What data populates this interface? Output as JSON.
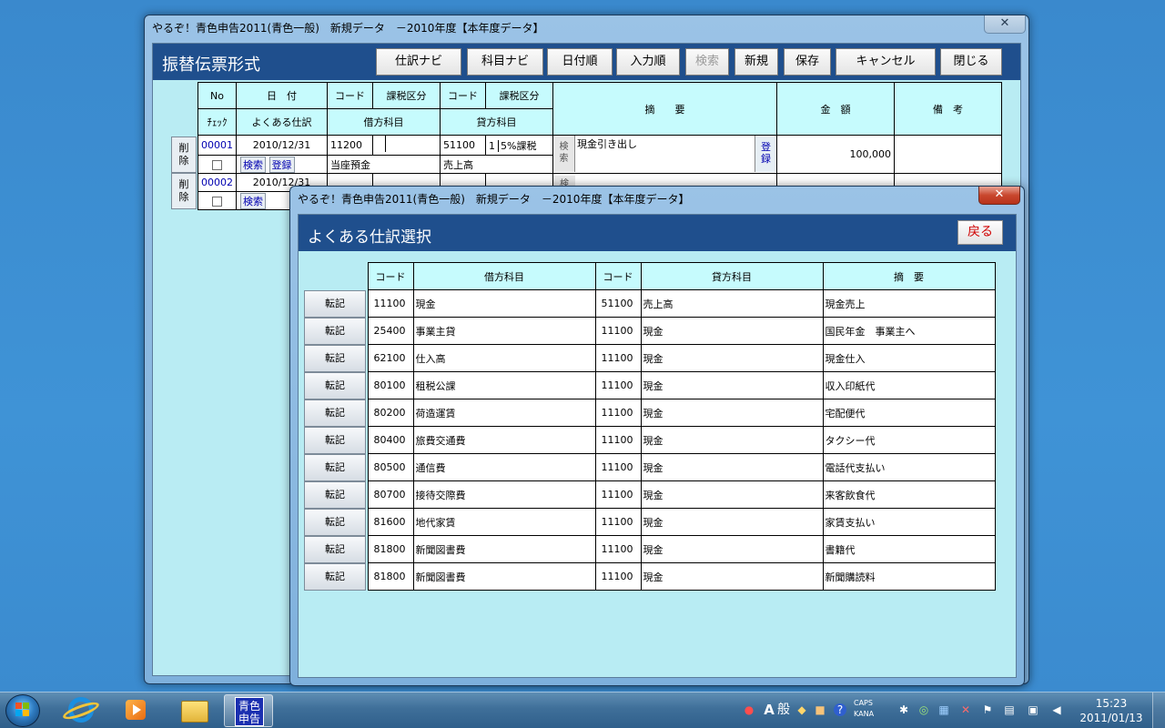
{
  "main_window": {
    "title": "やるぞ！青色申告2011(青色一般)　新規データ　－2010年度【本年度データ】",
    "close_label": "✕",
    "header_title": "振替伝票形式",
    "toolbar": [
      {
        "label": "仕訳ナビ",
        "disabled": false
      },
      {
        "label": "科目ナビ",
        "disabled": false
      },
      {
        "label": "日付順",
        "disabled": false
      },
      {
        "label": "入力順",
        "disabled": false
      },
      {
        "label": "検索",
        "disabled": true
      },
      {
        "label": "新規",
        "disabled": false
      },
      {
        "label": "保存",
        "disabled": false
      },
      {
        "label": "キャンセル",
        "disabled": false
      },
      {
        "label": "閉じる",
        "disabled": false
      }
    ],
    "grid_headers": {
      "no": "No",
      "date": "日　付",
      "code1": "コード",
      "tax1": "課税区分",
      "code2": "コード",
      "tax2": "課税区分",
      "summary": "摘　　要",
      "amount": "金　額",
      "note": "備　考",
      "check": "ﾁｪｯｸ",
      "frequent": "よくある仕訳",
      "debit": "借方科目",
      "credit": "貸方科目"
    },
    "rows": [
      {
        "delete_label": "削\n除",
        "no": "00001",
        "date": "2010/12/31",
        "debit_code": "11200",
        "credit_code": "51100",
        "credit_tax_no": "1",
        "credit_tax": "5%課税",
        "search_small": "検\n索",
        "summary": "現金引き出し",
        "register_small": "登\n録",
        "amount": "100,000",
        "search_btn": "検索",
        "register_btn": "登録",
        "debit_account": "当座預金",
        "credit_account": "売上高"
      },
      {
        "delete_label": "削\n除",
        "no": "00002",
        "date": "2010/12/31",
        "search_btn": "検索",
        "search_small": "検",
        "register_small": "登"
      }
    ]
  },
  "popup": {
    "title": "やるぞ！青色申告2011(青色一般)　新規データ　－2010年度【本年度データ】",
    "close_label": "✕",
    "header_title": "よくある仕訳選択",
    "back_label": "戻る",
    "headers": {
      "code": "コード",
      "debit": "借方科目",
      "code2": "コード",
      "credit": "貸方科目",
      "summary": "摘　要"
    },
    "transfer_label": "転記",
    "rows": [
      {
        "debit_code": "11100",
        "debit": "現金",
        "credit_code": "51100",
        "credit": "売上高",
        "summary": "現金売上"
      },
      {
        "debit_code": "25400",
        "debit": "事業主貸",
        "credit_code": "11100",
        "credit": "現金",
        "summary": "国民年金　事業主へ"
      },
      {
        "debit_code": "62100",
        "debit": "仕入高",
        "credit_code": "11100",
        "credit": "現金",
        "summary": "現金仕入"
      },
      {
        "debit_code": "80100",
        "debit": "租税公課",
        "credit_code": "11100",
        "credit": "現金",
        "summary": "収入印紙代"
      },
      {
        "debit_code": "80200",
        "debit": "荷造運賃",
        "credit_code": "11100",
        "credit": "現金",
        "summary": "宅配便代"
      },
      {
        "debit_code": "80400",
        "debit": "旅費交通費",
        "credit_code": "11100",
        "credit": "現金",
        "summary": "タクシー代"
      },
      {
        "debit_code": "80500",
        "debit": "通信費",
        "credit_code": "11100",
        "credit": "現金",
        "summary": "電話代支払い"
      },
      {
        "debit_code": "80700",
        "debit": "接待交際費",
        "credit_code": "11100",
        "credit": "現金",
        "summary": "来客飲食代"
      },
      {
        "debit_code": "81600",
        "debit": "地代家賃",
        "credit_code": "11100",
        "credit": "現金",
        "summary": "家賃支払い"
      },
      {
        "debit_code": "81800",
        "debit": "新聞図書費",
        "credit_code": "11100",
        "credit": "現金",
        "summary": "書籍代"
      },
      {
        "debit_code": "81800",
        "debit": "新聞図書費",
        "credit_code": "11100",
        "credit": "現金",
        "summary": "新聞購読料"
      }
    ]
  },
  "taskbar": {
    "app_label": "青色\n申告",
    "ime_mode": "A",
    "ime_kanji": "般",
    "caps": "CAPS",
    "kana": "KANA",
    "time": "15:23",
    "date": "2011/01/13",
    "icons": [
      "start-orb",
      "internet-explorer-icon",
      "media-player-icon",
      "file-explorer-icon",
      "aoiro-shinkoku-app-icon"
    ]
  },
  "colors": {
    "header_band": "#1f4f8d",
    "client_bg": "#b9ecf3",
    "header_cell": "#c6fbfd",
    "desktop": "#3f8fd0"
  }
}
